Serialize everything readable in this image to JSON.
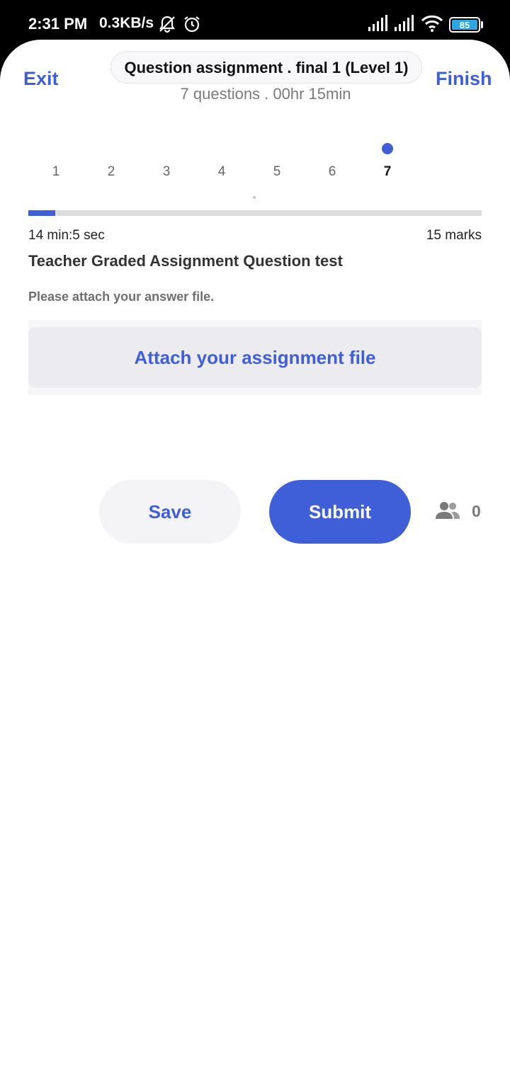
{
  "status_bar": {
    "time": "2:31 PM",
    "net_speed": "0.3KB/s",
    "battery": "85",
    "icons": [
      "mute-bell-icon",
      "alarm-icon",
      "signal-icon",
      "signal-icon",
      "wifi-icon",
      "battery-icon"
    ]
  },
  "header": {
    "exit_label": "Exit",
    "finish_label": "Finish",
    "title": "Question assignment . final 1 (Level 1)",
    "subtitle": "7 questions . 00hr 15min"
  },
  "question_nav": {
    "items": [
      "1",
      "2",
      "3",
      "4",
      "5",
      "6",
      "7"
    ],
    "active_index": 6
  },
  "progress": {
    "fraction": 0.06
  },
  "question": {
    "timer": "14 min:5 sec",
    "marks": "15 marks",
    "title": "Teacher Graded Assignment Question test",
    "instruction": "Please attach your answer file.",
    "attach_label": "Attach your assignment file"
  },
  "actions": {
    "save_label": "Save",
    "submit_label": "Submit",
    "participants_count": "0"
  },
  "colors": {
    "accent": "#3f5fd8",
    "battery": "#2aa6e0"
  }
}
